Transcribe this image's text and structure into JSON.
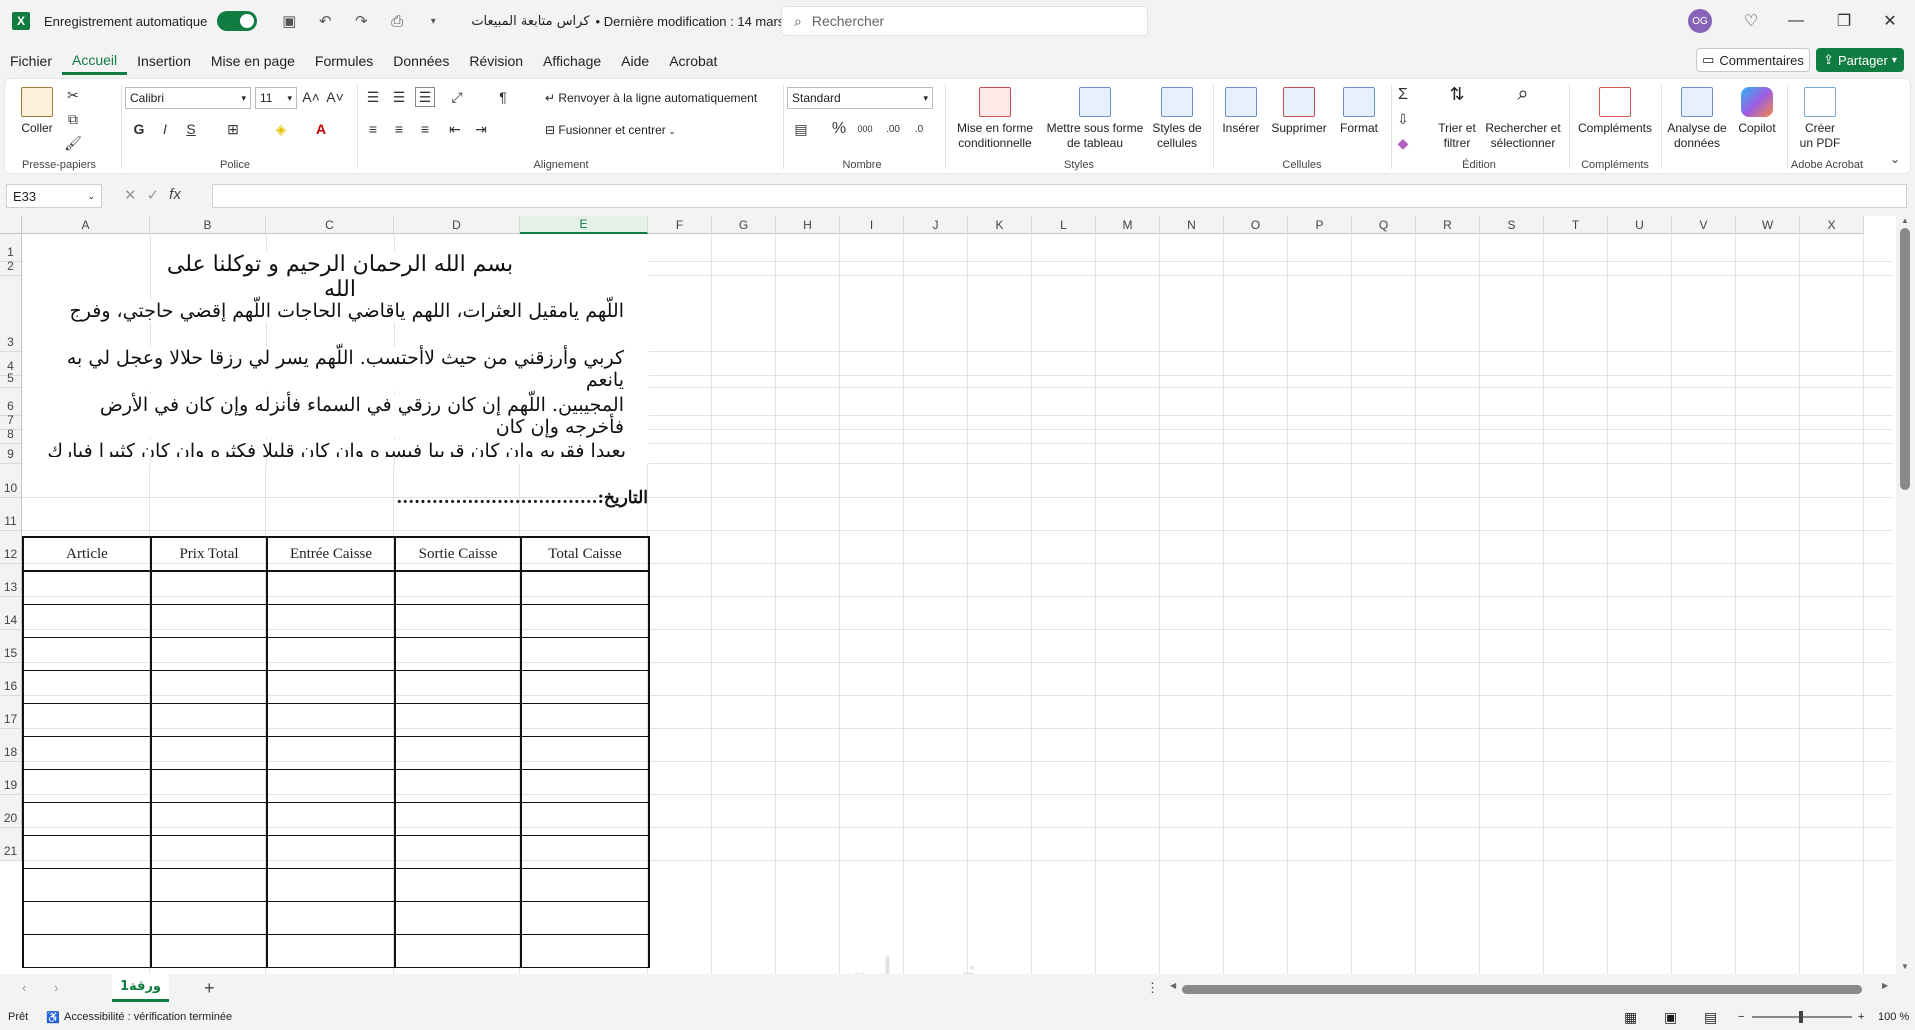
{
  "titlebar": {
    "autosave_label": "Enregistrement automatique",
    "doc_title": "كراس متابعة المبيعات",
    "modified": "• Dernière modification : 14 mars",
    "search_placeholder": "Rechercher",
    "avatar_initials": "OG"
  },
  "menu": {
    "items": [
      "Fichier",
      "Accueil",
      "Insertion",
      "Mise en page",
      "Formules",
      "Données",
      "Révision",
      "Affichage",
      "Aide",
      "Acrobat"
    ],
    "active": "Accueil",
    "comments_label": "Commentaires",
    "share_label": "Partager"
  },
  "ribbon": {
    "paste_label": "Coller",
    "clipboard_group": "Presse-papiers",
    "font_name": "Calibri",
    "font_size": "11",
    "font_group": "Police",
    "bold": "G",
    "italic": "I",
    "underline": "S",
    "wrap_label": "Renvoyer à la ligne automatiquement",
    "merge_label": "Fusionner et centrer",
    "alignment_group": "Alignement",
    "number_format": "Standard",
    "number_group": "Nombre",
    "cond_format_l1": "Mise en forme",
    "cond_format_l2": "conditionnelle",
    "table_format_l1": "Mettre sous forme",
    "table_format_l2": "de tableau",
    "cell_styles_l1": "Styles de",
    "cell_styles_l2": "cellules",
    "styles_group": "Styles",
    "insert_label": "Insérer",
    "delete_label": "Supprimer",
    "format_label": "Format",
    "cells_group": "Cellules",
    "sort_l1": "Trier et",
    "sort_l2": "filtrer",
    "find_l1": "Rechercher et",
    "find_l2": "sélectionner",
    "editing_group": "Édition",
    "addins_label": "Compléments",
    "addins_group": "Compléments",
    "analyze_l1": "Analyse de",
    "analyze_l2": "données",
    "copilot_label": "Copilot",
    "pdf_l1": "Créer",
    "pdf_l2": "un PDF",
    "acrobat_group": "Adobe Acrobat"
  },
  "formula_bar": {
    "cell_ref": "E33",
    "fx": "fx",
    "content": ""
  },
  "grid": {
    "columns": [
      "A",
      "B",
      "C",
      "D",
      "E",
      "F",
      "G",
      "H",
      "I",
      "J",
      "K",
      "L",
      "M",
      "N",
      "O",
      "P",
      "Q",
      "R",
      "S",
      "T",
      "U",
      "V",
      "W",
      "X"
    ],
    "selected_column": "E",
    "rows": [
      "1",
      "2",
      "3",
      "4",
      "5",
      "6",
      "7",
      "8",
      "9",
      "10",
      "11",
      "12",
      "13",
      "14",
      "15",
      "16",
      "17",
      "18",
      "19",
      "20",
      "21"
    ]
  },
  "sheet_content": {
    "basmala": "بسم الله الرحمان الرحيم و توكلنا على الله",
    "dua_line1": "اللّهم يامقيل العثرات، اللهم ياقاضي الحاجات اللّهم إقضي حاجتي، وفرج",
    "dua_line2": "كربي وأرزقني من حيث لاأحتسب. اللّهم يسر لي رزقا حلالا وعجل لي به يانعم",
    "dua_line3": "المجيبين. اللّهم إن كان رزقي في السماء فأنزله وإن كان في الأرض فأخرجه وإن كان",
    "dua_line4": "بعيدا فقربه وإن كان قريبا فيسره وإن كان قليلا فكثره وإن كان كثيرا فبارك لي فيه.",
    "date_label": "التاريخ:..................................",
    "table_headers": [
      "Article",
      "Prix Total",
      "Entrée Caisse",
      "Sortie Caisse",
      "Total Caisse"
    ]
  },
  "sheetbar": {
    "tab_name": "ورقة1",
    "add_sheet": "+"
  },
  "status": {
    "ready": "Prêt",
    "accessibility": "Accessibilité : vérification terminée",
    "zoom": "100 %"
  },
  "watermark": "خمسات"
}
